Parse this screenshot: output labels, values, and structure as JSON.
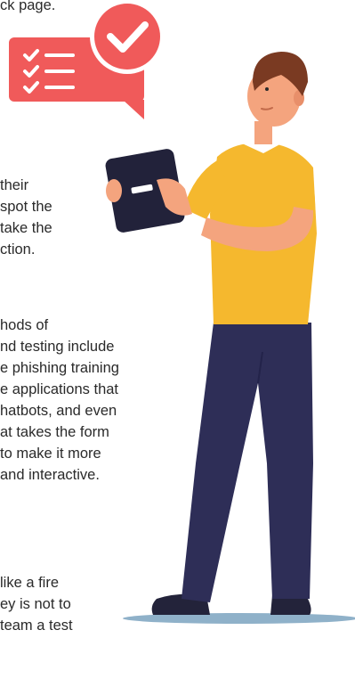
{
  "text_blocks": [
    {
      "lines": [
        "ck page."
      ]
    },
    {
      "lines": [
        "their",
        "spot the",
        "take the",
        "ction."
      ]
    },
    {
      "lines": [
        "hods of",
        "nd testing include",
        "e phishing training",
        "e applications that",
        "hatbots, and even",
        "at takes the form",
        "to make it more",
        "and interactive."
      ]
    },
    {
      "lines": [
        "like a fire",
        "ey is not to",
        "team a test"
      ]
    }
  ],
  "icons": {
    "checklist_bubble": "checklist-speech-bubble-icon",
    "check_badge": "checkmark-circle-icon"
  },
  "colors": {
    "bubble_red": "#f05a5a",
    "shirt_yellow": "#f5b82e",
    "pants_navy": "#2e2e57",
    "hair_brown": "#7a3a22",
    "skin": "#f4a47e",
    "tablet": "#22223a",
    "shadow": "#8fb1c9"
  }
}
